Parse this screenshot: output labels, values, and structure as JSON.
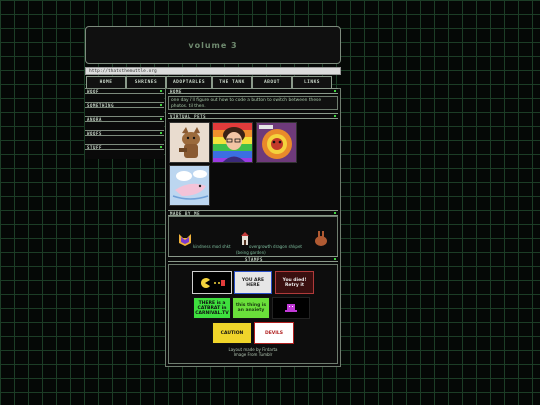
{
  "banner": {
    "title": "volume 3"
  },
  "url_bar": {
    "text": "http://thatsthemuttle.org"
  },
  "nav": {
    "items": [
      "HOME",
      "SHRINES",
      "ADOPTABLES",
      "THE TANK",
      "ABOUT",
      "LINKS"
    ]
  },
  "sidebar": {
    "sections": [
      "WOOF",
      "SOMETHING",
      "ANORA",
      "WOOFS",
      "STUFF"
    ]
  },
  "main": {
    "home_header": "HOME",
    "home_text": "one day i'll figure out how to code a button to switch between these photos. til then.",
    "pets_header": "VIRTUAL PETS",
    "made_header": "MADE BY ME",
    "made_items": [
      "kindness mod shkt",
      "overgrowth dragon shkpet",
      "(being garden)"
    ],
    "stamps_header": "STAMPS",
    "stamps": [
      {
        "text": "",
        "bg": "#000000"
      },
      {
        "text": "YOU ARE HERE",
        "bg": "#e6e6e6"
      },
      {
        "text": "You died! Retry it",
        "bg": "#3a0f0f"
      },
      {
        "text": "THERE is a CATBRAT in CARNIVAL.TV",
        "bg": "#3ee03e"
      },
      {
        "text": "this thing is an anxiety",
        "bg": "#6adf3a"
      },
      {
        "text": "",
        "bg": "#000000"
      },
      {
        "text": "CAUTION",
        "bg": "#f0d52a"
      },
      {
        "text": "DEVILS",
        "bg": "#ffffff"
      }
    ],
    "credit_line1": "Layout made by Firdarta",
    "credit_line2": "Image From Tumblr"
  },
  "colors": {
    "accent": "#3fd43f",
    "grid": "#1c3d26",
    "panel_border": "#6f7d6f"
  }
}
